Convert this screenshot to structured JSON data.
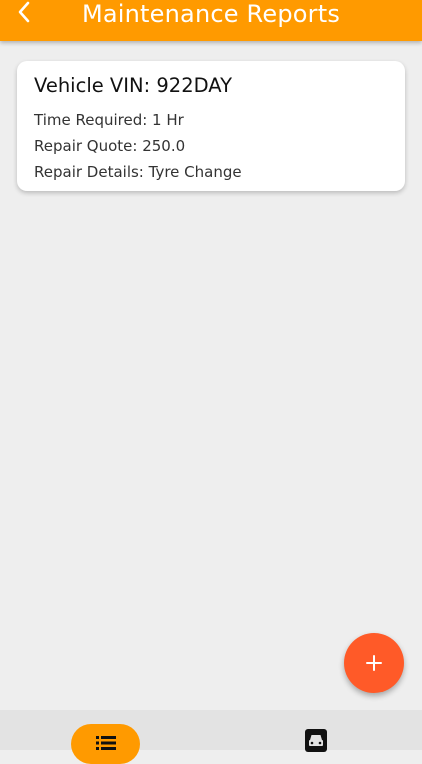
{
  "app_bar": {
    "title": "Maintenance Reports",
    "back_icon": "chevron-left-icon",
    "color": "#ff9a00"
  },
  "reports": [
    {
      "title": "Vehicle VIN: 922DAY",
      "time_required": "Time Required: 1 Hr",
      "repair_quote": "Repair Quote: 250.0",
      "repair_details": "Repair Details: Tyre Change"
    }
  ],
  "fab": {
    "icon": "plus-icon",
    "color": "#ff5a28"
  },
  "bottom_nav": {
    "tabs": [
      {
        "icon": "list-icon",
        "active": true
      },
      {
        "icon": "car-icon",
        "active": false
      }
    ]
  }
}
